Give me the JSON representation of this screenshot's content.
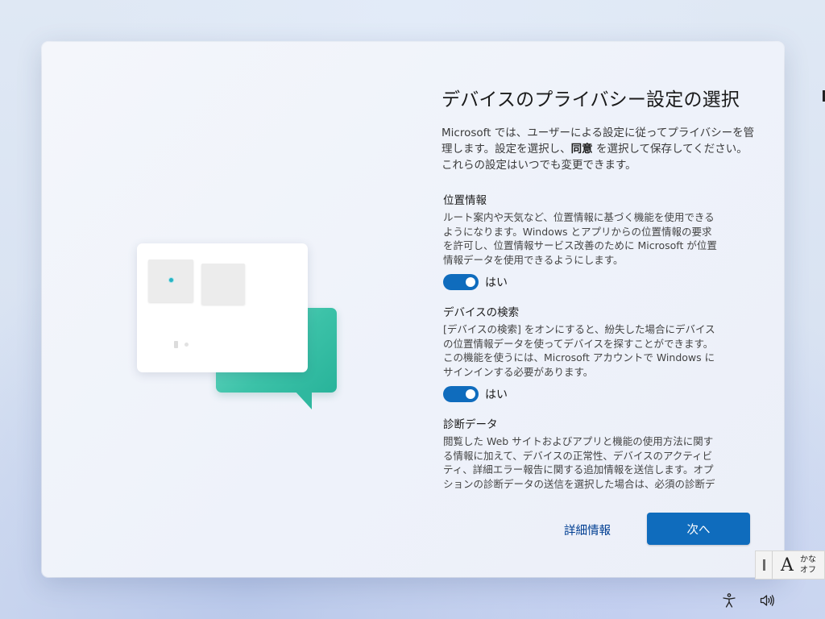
{
  "page": {
    "title": "デバイスのプライバシー設定の選択",
    "intro_before": "Microsoft では、ユーザーによる設定に従ってプライバシーを管理します。設定を選択し、",
    "intro_bold": "同意",
    "intro_after": " を選択して保存してください。これらの設定はいつでも変更できます。"
  },
  "settings": [
    {
      "title": "位置情報",
      "description": "ルート案内や天気など、位置情報に基づく機能を使用できるようになります。Windows とアプリからの位置情報の要求を許可し、位置情報サービス改善のために Microsoft が位置情報データを使用できるようにします。",
      "toggle_on": true,
      "toggle_label": "はい"
    },
    {
      "title": "デバイスの検索",
      "description": "[デバイスの検索] をオンにすると、紛失した場合にデバイスの位置情報データを使ってデバイスを探すことができます。この機能を使うには、Microsoft アカウントで Windows にサインインする必要があります。",
      "toggle_on": true,
      "toggle_label": "はい"
    },
    {
      "title": "診断データ",
      "description": "閲覧した Web サイトおよびアプリと機能の使用方法に関する情報に加えて、デバイスの正常性、デバイスのアクティビティ、詳細エラー報告に関する追加情報を送信します。オプションの診断データの送信を選択した場合は、必須の診断データが常に含まれます。"
    }
  ],
  "buttons": {
    "learn_more": "詳細情報",
    "next": "次へ"
  },
  "ime": {
    "mode_char": "A",
    "line1": "かな",
    "line2": "オフ"
  },
  "tray": {
    "accessibility_icon": "accessibility-icon",
    "volume_icon": "volume-icon"
  },
  "colors": {
    "accent": "#0f6cbd",
    "link": "#003e92",
    "illustration_green": "#3cc2a8"
  }
}
